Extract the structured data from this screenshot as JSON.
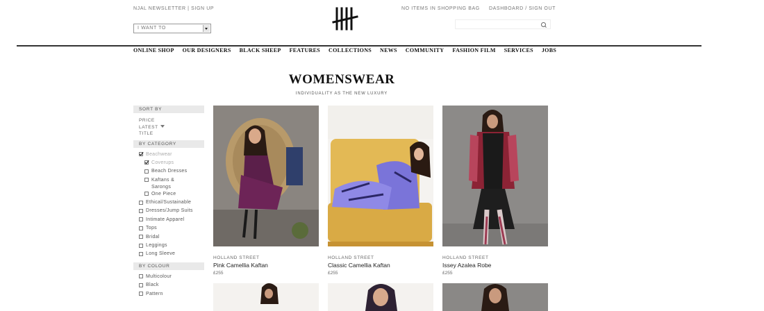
{
  "header": {
    "newsletter": "NJAL NEWSLETTER | SIGN UP",
    "i_want_to": "I WANT TO",
    "bag_status": "NO ITEMS IN SHOPPING BAG",
    "account_links": "DASHBOARD / SIGN OUT",
    "search_placeholder": ""
  },
  "nav": [
    "ONLINE SHOP",
    "OUR DESIGNERS",
    "BLACK SHEEP",
    "FEATURES",
    "COLLECTIONS",
    "NEWS",
    "COMMUNITY",
    "FASHION FILM",
    "SERVICES",
    "JOBS"
  ],
  "page": {
    "title": "WOMENSWEAR",
    "subtitle": "INDIVIDUALITY AS THE NEW LUXURY"
  },
  "sidebar": {
    "sort_heading": "SORT BY",
    "sort_options": [
      "PRICE",
      "LATEST",
      "TITLE"
    ],
    "category_heading": "BY CATEGORY",
    "categories": [
      {
        "label": "Beachwear",
        "checked": true,
        "sub": false,
        "dim": true
      },
      {
        "label": "Coverups",
        "checked": true,
        "sub": true,
        "dim": true
      },
      {
        "label": "Beach Dresses",
        "checked": false,
        "sub": true,
        "dim": false
      },
      {
        "label": "Kaftans & Sarongs",
        "checked": false,
        "sub": true,
        "dim": false
      },
      {
        "label": "One Piece",
        "checked": false,
        "sub": true,
        "dim": false
      },
      {
        "label": "Ethical/Sustainable",
        "checked": false,
        "sub": false,
        "dim": false
      },
      {
        "label": "Dresses/Jump Suits",
        "checked": false,
        "sub": false,
        "dim": false
      },
      {
        "label": "Intimate Apparel",
        "checked": false,
        "sub": false,
        "dim": false
      },
      {
        "label": "Tops",
        "checked": false,
        "sub": false,
        "dim": false
      },
      {
        "label": "Bridal",
        "checked": false,
        "sub": false,
        "dim": false
      },
      {
        "label": "Leggings",
        "checked": false,
        "sub": false,
        "dim": false
      },
      {
        "label": "Long Sleeve",
        "checked": false,
        "sub": false,
        "dim": false
      }
    ],
    "colour_heading": "BY COLOUR",
    "colours": [
      {
        "label": "Multicolour",
        "checked": false
      },
      {
        "label": "Black",
        "checked": false
      },
      {
        "label": "Pattern",
        "checked": false
      }
    ]
  },
  "products": [
    {
      "brand": "HOLLAND STREET",
      "name": "Pink Camellia Kaftan",
      "price": "£255"
    },
    {
      "brand": "HOLLAND STREET",
      "name": "Classic Camellia Kaftan",
      "price": "£255"
    },
    {
      "brand": "HOLLAND STREET",
      "name": "Issey Azalea Robe",
      "price": "£255"
    }
  ],
  "colors": {
    "accent_text": "#111111",
    "muted_text": "#777777",
    "section_bg": "#e9e9e9"
  }
}
